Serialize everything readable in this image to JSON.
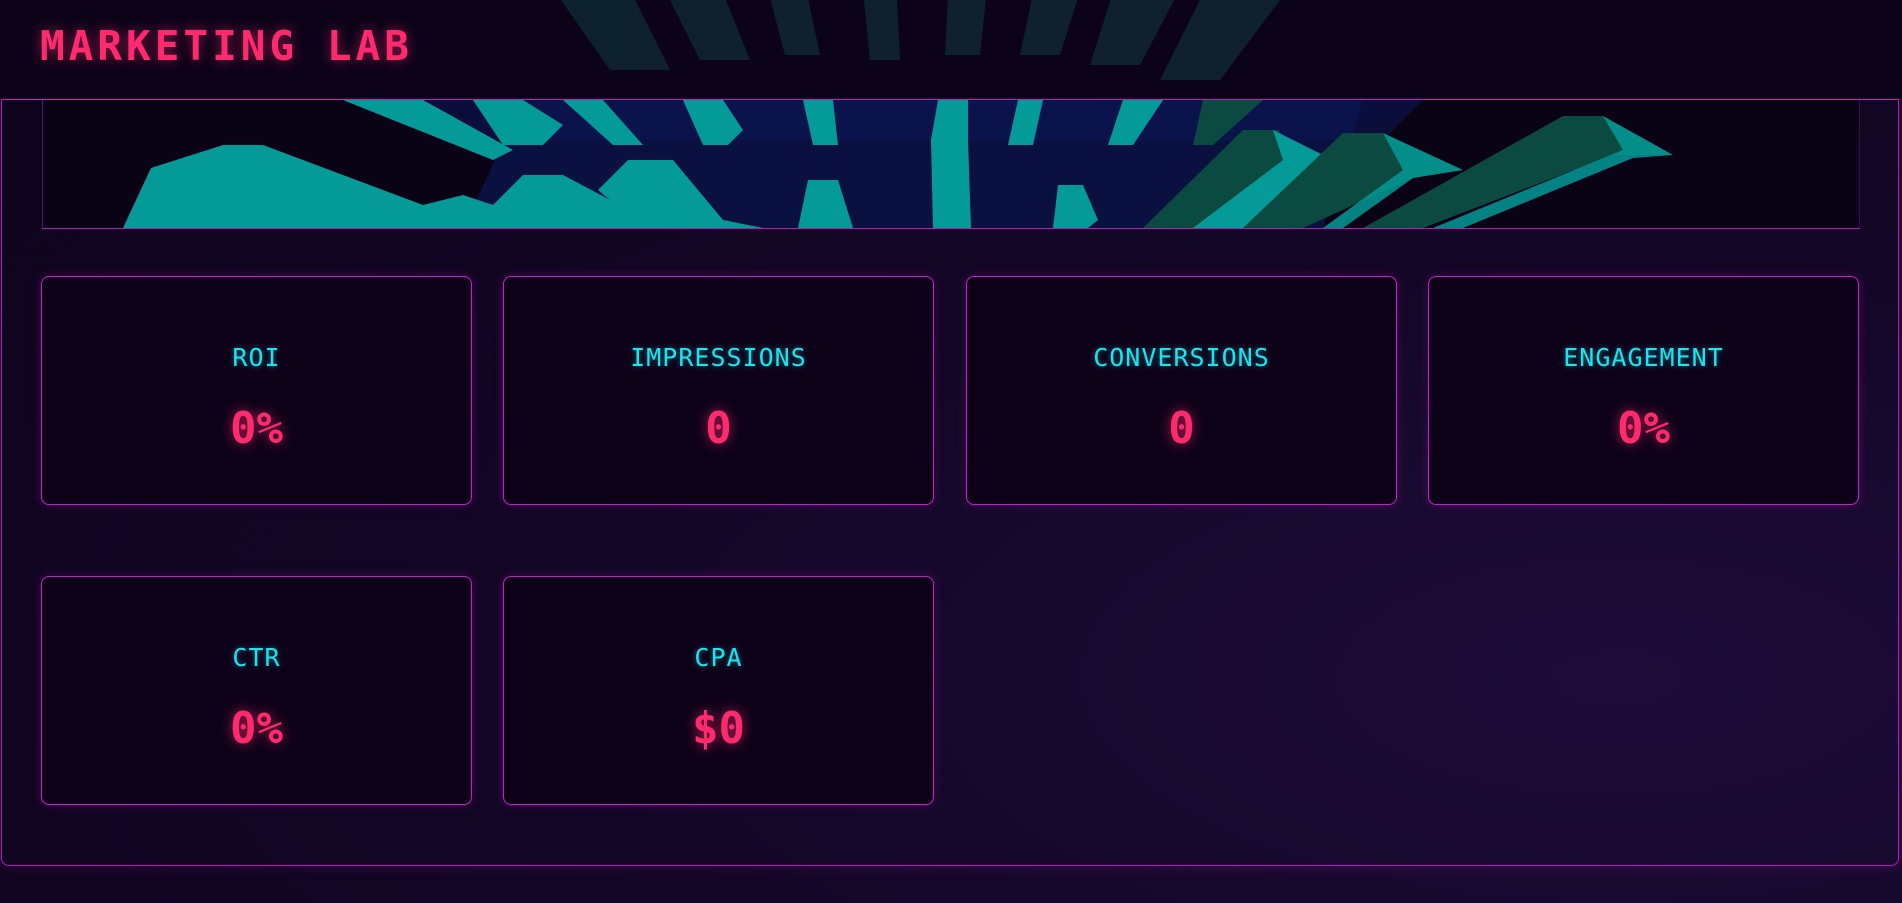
{
  "app": {
    "title": "MARKETING LAB"
  },
  "colors": {
    "accent_pink": "#ff2a6d",
    "accent_cyan": "#19e5ee",
    "border_magenta": "#c51ecb",
    "background": "#0f0520"
  },
  "metrics": [
    {
      "label": "ROI",
      "value": "0%"
    },
    {
      "label": "IMPRESSIONS",
      "value": "0"
    },
    {
      "label": "CONVERSIONS",
      "value": "0"
    },
    {
      "label": "ENGAGEMENT",
      "value": "0%"
    },
    {
      "label": "CTR",
      "value": "0%"
    },
    {
      "label": "CPA",
      "value": "$0"
    }
  ]
}
